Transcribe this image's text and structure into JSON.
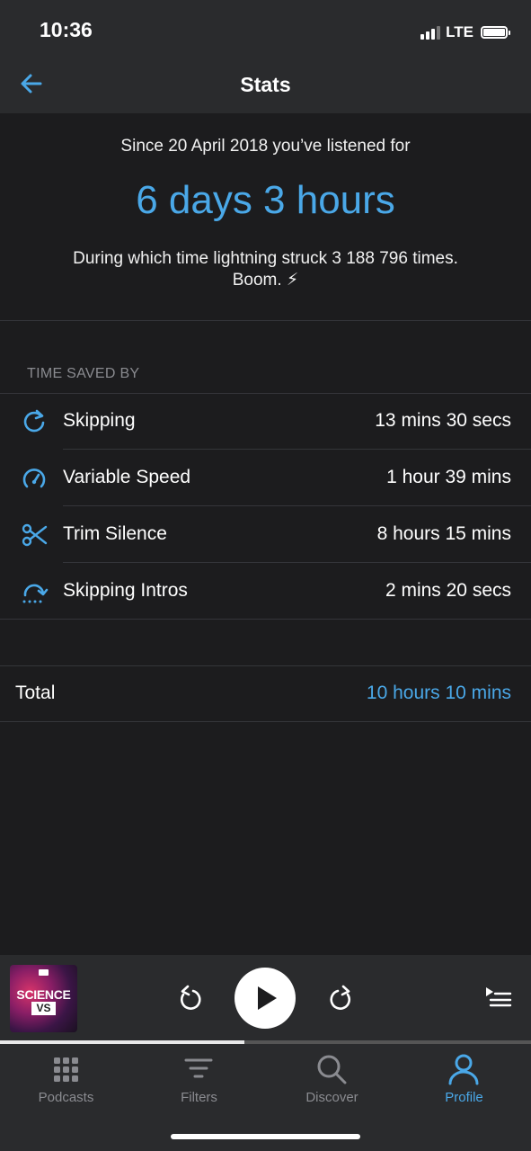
{
  "status_bar": {
    "time": "10:36",
    "network": "LTE"
  },
  "nav": {
    "title": "Stats",
    "back_icon": "arrow-left-icon"
  },
  "summary": {
    "since_text": "Since 20 April 2018 you’ve listened for",
    "duration": "6 days 3 hours",
    "lightning_line": "During which time lightning struck 3 188 796 times.",
    "boom_line": "Boom. ⚡"
  },
  "time_saved": {
    "header": "TIME SAVED BY",
    "rows": [
      {
        "icon": "skip-icon",
        "label": "Skipping",
        "value": "13 mins 30 secs"
      },
      {
        "icon": "speedometer-icon",
        "label": "Variable Speed",
        "value": "1 hour 39 mins"
      },
      {
        "icon": "scissors-icon",
        "label": "Trim Silence",
        "value": "8 hours 15 mins"
      },
      {
        "icon": "skip-intro-icon",
        "label": "Skipping Intros",
        "value": "2 mins 20 secs"
      }
    ]
  },
  "total": {
    "label": "Total",
    "value": "10 hours 10 mins"
  },
  "player": {
    "artwork_title": "SCIENCE",
    "artwork_subtitle": "VS",
    "progress": 0.46
  },
  "tabs": [
    {
      "label": "Podcasts",
      "icon": "grid-icon",
      "active": false
    },
    {
      "label": "Filters",
      "icon": "filter-icon",
      "active": false
    },
    {
      "label": "Discover",
      "icon": "search-icon",
      "active": false
    },
    {
      "label": "Profile",
      "icon": "profile-icon",
      "active": true
    }
  ],
  "colors": {
    "accent": "#4aa8e8",
    "background": "#1c1c1e",
    "bar": "#2a2b2d"
  }
}
